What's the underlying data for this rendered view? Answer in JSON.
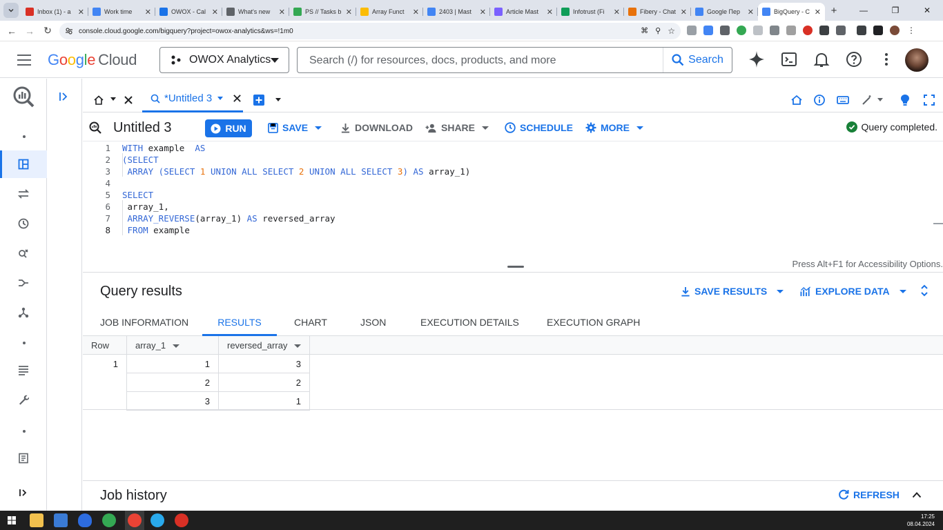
{
  "browser": {
    "tabs": [
      {
        "title": "Inbox (1) - a",
        "color": "#d93025"
      },
      {
        "title": "Work time",
        "color": "#4285f4"
      },
      {
        "title": "OWOX - Cal",
        "color": "#1a73e8"
      },
      {
        "title": "What's new",
        "color": "#5f6368"
      },
      {
        "title": "PS // Tasks b",
        "color": "#34a853"
      },
      {
        "title": "Array Funct",
        "color": "#fbbc04"
      },
      {
        "title": "2403 | Mast",
        "color": "#4285f4"
      },
      {
        "title": "Article Mast",
        "color": "#7b61ff"
      },
      {
        "title": "Infotrust (Fi",
        "color": "#0f9d58"
      },
      {
        "title": "Fibery - Chat",
        "color": "#e8710a"
      },
      {
        "title": "Google Пер",
        "color": "#4285f4"
      },
      {
        "title": "BigQuery - C",
        "color": "#4285f4"
      }
    ],
    "new_tab": "+",
    "url": "console.cloud.google.com/bigquery?project=owox-analytics&ws=!1m0"
  },
  "header": {
    "logo_google": [
      "G",
      "o",
      "o",
      "g",
      "l",
      "e"
    ],
    "logo_colors": [
      "#4285f4",
      "#ea4335",
      "#fbbc04",
      "#4285f4",
      "#34a853",
      "#ea4335"
    ],
    "logo_cloud": "Cloud",
    "project": "OWOX Analytics",
    "search_placeholder": "Search (/) for resources, docs, products, and more",
    "search_button": "Search"
  },
  "editor_tabs": {
    "active": "*Untitled 3"
  },
  "toolbar": {
    "title": "Untitled 3",
    "run": "RUN",
    "save": "SAVE",
    "download": "DOWNLOAD",
    "share": "SHARE",
    "schedule": "SCHEDULE",
    "more": "MORE",
    "status": "Query completed."
  },
  "editor": {
    "line_numbers": [
      "1",
      "2",
      "3",
      "4",
      "5",
      "6",
      "7",
      "8"
    ],
    "lines": [
      [
        {
          "t": "WITH",
          "c": "kw"
        },
        {
          "t": " example  ",
          "c": ""
        },
        {
          "t": "AS",
          "c": "kw"
        }
      ],
      [
        {
          "t": "(SELECT",
          "c": "kw"
        }
      ],
      [
        {
          "t": " ARRAY",
          "c": "kw"
        },
        {
          "t": " (",
          "c": "kw"
        },
        {
          "t": "SELECT",
          "c": "kw"
        },
        {
          "t": " ",
          "c": ""
        },
        {
          "t": "1",
          "c": "num"
        },
        {
          "t": " UNION ALL SELECT ",
          "c": "kw"
        },
        {
          "t": "2",
          "c": "num"
        },
        {
          "t": " UNION ALL SELECT ",
          "c": "kw"
        },
        {
          "t": "3",
          "c": "num"
        },
        {
          "t": ") ",
          "c": "kw"
        },
        {
          "t": "AS",
          "c": "kw"
        },
        {
          "t": " array_1)",
          "c": ""
        }
      ],
      [],
      [
        {
          "t": "SELECT",
          "c": "kw"
        }
      ],
      [
        {
          "t": " array_1,",
          "c": ""
        }
      ],
      [
        {
          "t": " ARRAY_REVERSE",
          "c": "fn"
        },
        {
          "t": "(array_1) ",
          "c": ""
        },
        {
          "t": "AS",
          "c": "kw"
        },
        {
          "t": " reversed_array",
          "c": ""
        }
      ],
      [
        {
          "t": " FROM",
          "c": "kw"
        },
        {
          "t": " example",
          "c": ""
        }
      ]
    ],
    "accessibility_hint": "Press Alt+F1 for Accessibility Options."
  },
  "results": {
    "title": "Query results",
    "save_results": "SAVE RESULTS",
    "explore_data": "EXPLORE DATA",
    "tabs": [
      "JOB INFORMATION",
      "RESULTS",
      "CHART",
      "JSON",
      "EXECUTION DETAILS",
      "EXECUTION GRAPH"
    ],
    "columns": [
      "Row",
      "array_1",
      "reversed_array"
    ],
    "rows": [
      {
        "row": "1",
        "array_1": "1",
        "reversed_array": "3"
      },
      {
        "row": "",
        "array_1": "2",
        "reversed_array": "2"
      },
      {
        "row": "",
        "array_1": "3",
        "reversed_array": "1"
      }
    ]
  },
  "job_history": {
    "title": "Job history",
    "refresh": "REFRESH"
  },
  "taskbar": {
    "time": "17:25",
    "date": "08.04.2024"
  },
  "colors": {
    "accent": "#1a73e8",
    "success": "#188038"
  }
}
